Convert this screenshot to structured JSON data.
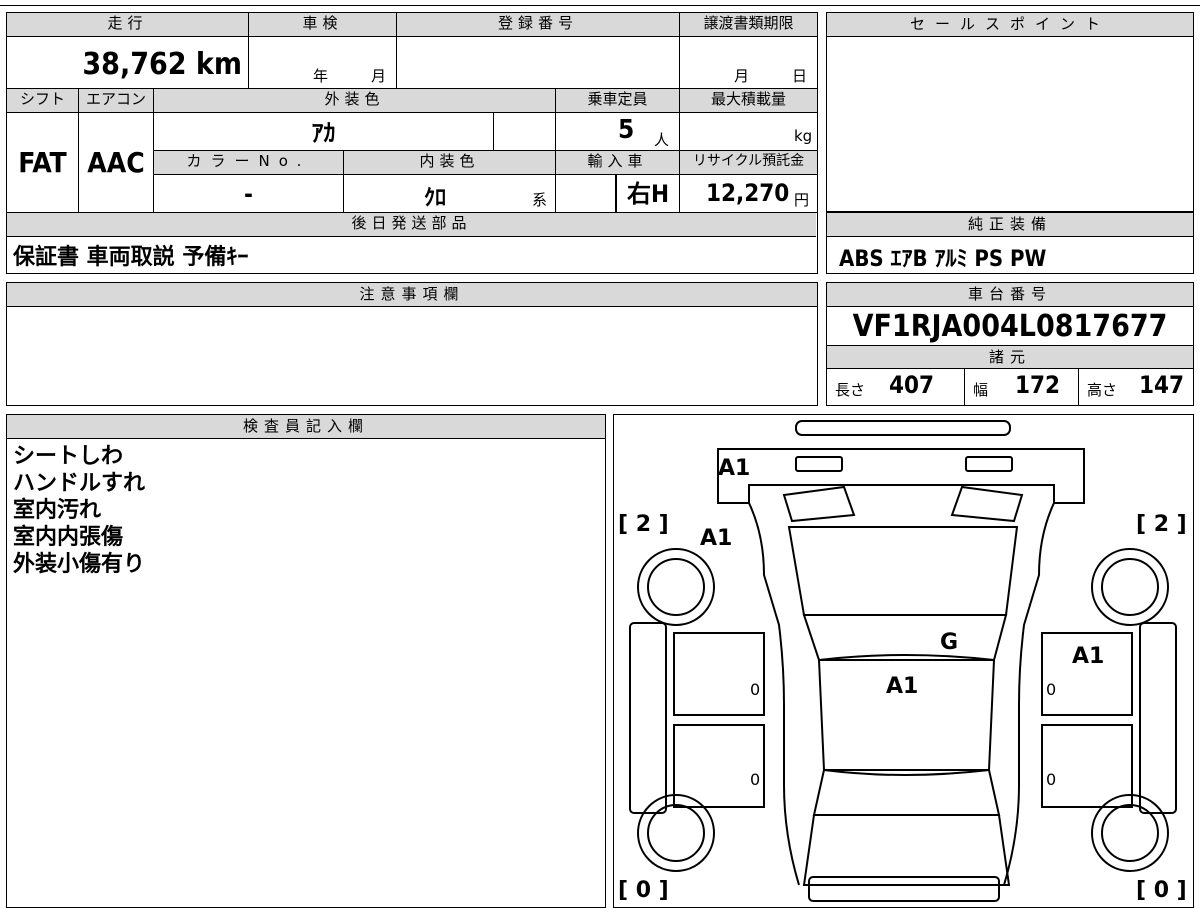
{
  "form": {
    "mileage": {
      "header": "走行",
      "value": "38,762 km"
    },
    "inspection": {
      "header": "車検",
      "year": "年",
      "month": "月"
    },
    "registration": {
      "header": "登録番号",
      "value": ""
    },
    "transfer_deadline": {
      "header": "譲渡書類期限",
      "month": "月",
      "day": "日"
    },
    "shift": {
      "header": "シフト",
      "value": "FAT"
    },
    "aircon": {
      "header": "エアコン",
      "value": "AAC"
    },
    "exterior_color": {
      "header": "外装色",
      "value": "ｱｶ"
    },
    "capacity": {
      "header": "乗車定員",
      "value": "5",
      "unit": "人"
    },
    "max_load": {
      "header": "最大積載量",
      "value": "",
      "unit": "kg"
    },
    "color_no": {
      "header": "カラーNo.",
      "value": "-"
    },
    "interior_color": {
      "header": "内装色",
      "value": "ｸﾛ",
      "suffix": "系"
    },
    "import": {
      "header": "輸入車",
      "value": "右H"
    },
    "recycle": {
      "header": "リサイクル預託金",
      "value": "12,270",
      "unit": "円"
    },
    "later_parts": {
      "header": "後日発送部品",
      "value": "保証書 車両取説 予備ｷｰ"
    },
    "notes": {
      "header": "注意事項欄",
      "value": ""
    },
    "sales_point": {
      "header": "セールスポイント",
      "value": ""
    },
    "equipment": {
      "header": "純正装備",
      "value": "ABS ｴｱB ｱﾙﾐ PS PW"
    },
    "chassis": {
      "header": "車台番号",
      "value": "VF1RJA004L0817677"
    },
    "specs": {
      "header": "諸元",
      "length": {
        "label": "長さ",
        "value": "407"
      },
      "width": {
        "label": "幅",
        "value": "172"
      },
      "height": {
        "label": "高さ",
        "value": "147"
      }
    },
    "inspector": {
      "header": "検査員記入欄",
      "lines": [
        "シートしわ",
        "ハンドルすれ",
        "室内汚れ",
        "室内内張傷",
        "外装小傷有り"
      ]
    }
  },
  "diagram": {
    "marks": {
      "front": "A1",
      "hood": "A1",
      "fender_right": "A1",
      "windshield": "G",
      "roof": "A1"
    },
    "tires": {
      "front_left": "[ 2 ]",
      "front_right": "[ 2 ]",
      "rear_left": "[ 0 ]",
      "rear_right": "[ 0 ]"
    },
    "panel_values": {
      "left_front": "0",
      "left_rear": "0",
      "right_front": "0",
      "right_rear": "0"
    }
  }
}
